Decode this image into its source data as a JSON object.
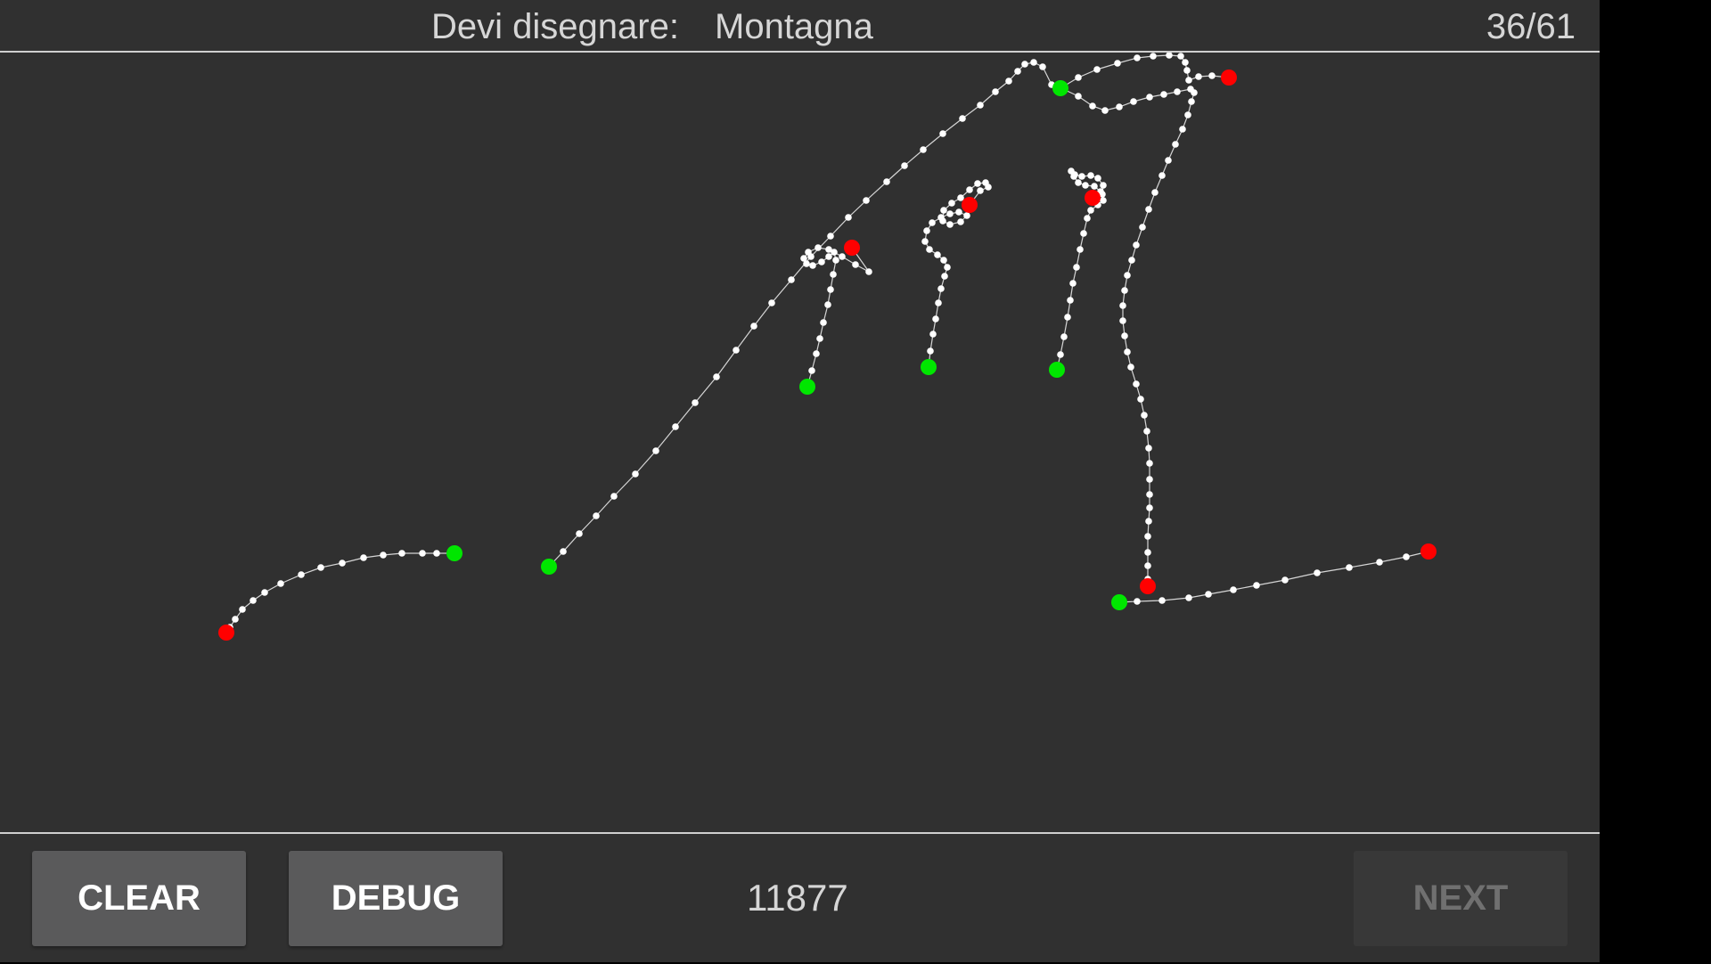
{
  "header": {
    "prompt_label": "Devi disegnare:",
    "prompt_word": "Montagna",
    "progress": "36/61"
  },
  "footer": {
    "clear_label": "CLEAR",
    "debug_label": "DEBUG",
    "score": "11877",
    "next_label": "NEXT"
  },
  "colors": {
    "background": "#303030",
    "stroke": "#ffffff",
    "stroke_start": "#00e600",
    "stroke_end": "#ff0000",
    "button": "#5a5a5b",
    "button_disabled": "#383838"
  }
}
